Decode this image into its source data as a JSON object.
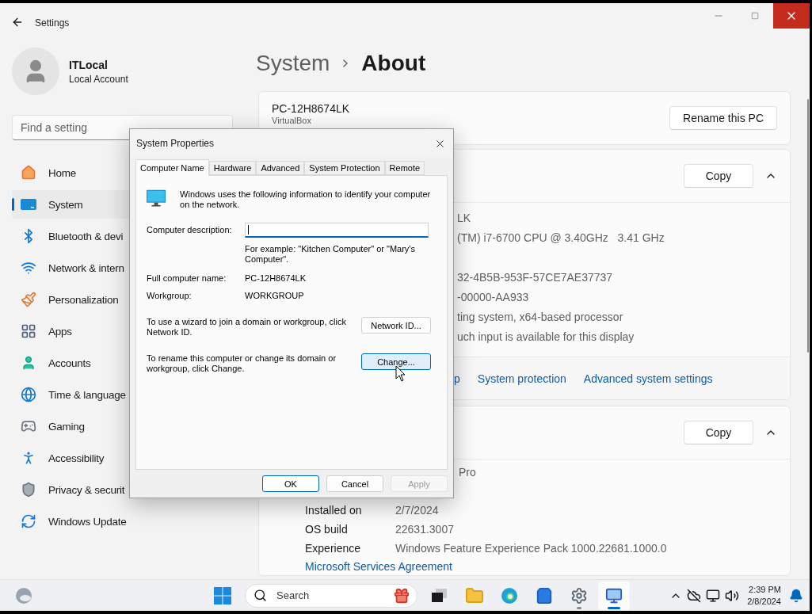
{
  "window": {
    "title": "Settings"
  },
  "profile": {
    "name": "ITLocal",
    "account": "Local Account"
  },
  "search": {
    "placeholder": "Find a setting"
  },
  "nav": [
    {
      "label": "Home",
      "selected": false
    },
    {
      "label": "System",
      "selected": true
    },
    {
      "label": "Bluetooth & devi",
      "selected": false
    },
    {
      "label": "Network & intern",
      "selected": false
    },
    {
      "label": "Personalization",
      "selected": false
    },
    {
      "label": "Apps",
      "selected": false
    },
    {
      "label": "Accounts",
      "selected": false
    },
    {
      "label": "Time & language",
      "selected": false
    },
    {
      "label": "Gaming",
      "selected": false
    },
    {
      "label": "Accessibility",
      "selected": false
    },
    {
      "label": "Privacy & securit",
      "selected": false
    },
    {
      "label": "Windows Update",
      "selected": false
    }
  ],
  "breadcrumb": {
    "parent": "System",
    "current": "About"
  },
  "device": {
    "name": "PC-12H8674LK",
    "model": "VirtualBox",
    "button": "Rename this PC"
  },
  "device_specs": {
    "button": "Copy",
    "expanded": true,
    "values": [
      {
        "value": "LK"
      },
      {
        "value": "(TM) i7-6700 CPU @ 3.40GHz   3.41 GHz"
      },
      {
        "value": "32-4B5B-953F-57CE7AE37737"
      },
      {
        "value": "-00000-AA933"
      },
      {
        "value": "ting system, x64-based processor"
      },
      {
        "value": "uch input is available for this display"
      }
    ],
    "links": [
      "p",
      "System protection",
      "Advanced system settings"
    ]
  },
  "windows_specs": {
    "button": "Copy",
    "expanded": true,
    "edition": "Pro",
    "rows": [
      {
        "label": "Installed on",
        "value": "2/7/2024"
      },
      {
        "label": "OS build",
        "value": "22631.3007"
      },
      {
        "label": "Experience",
        "value": "Windows Feature Experience Pack 1000.22681.1000.0"
      }
    ],
    "link": "Microsoft Services Agreement"
  },
  "dialog": {
    "title": "System Properties",
    "tabs": [
      {
        "label": "Computer Name",
        "selected": true
      },
      {
        "label": "Hardware",
        "selected": false
      },
      {
        "label": "Advanced",
        "selected": false
      },
      {
        "label": "System Protection",
        "selected": false
      },
      {
        "label": "Remote",
        "selected": false
      }
    ],
    "intro": "Windows uses the following information to identify your computer on the network.",
    "description": {
      "label": "Computer description:",
      "focused": true
    },
    "example": "For example: \"Kitchen Computer\" or \"Mary's Computer\".",
    "full_name": {
      "label": "Full computer name:",
      "value": "PC-12H8674LK"
    },
    "workgroup": {
      "label": "Workgroup:",
      "value": "WORKGROUP"
    },
    "actions": [
      {
        "text": "To use a wizard to join a domain or workgroup, click Network ID.",
        "button": "Network ID...",
        "hovered": false
      },
      {
        "text": "To rename this computer or change its domain or workgroup, click Change.",
        "button": "Change...",
        "hovered": true
      }
    ],
    "buttons": [
      {
        "label": "OK",
        "default": true,
        "disabled": false
      },
      {
        "label": "Cancel",
        "default": false,
        "disabled": false
      },
      {
        "label": "Apply",
        "default": false,
        "disabled": true
      }
    ]
  },
  "taskbar": {
    "search": {
      "placeholder": "Search"
    },
    "apps": [
      {
        "running": false,
        "active": false
      },
      {
        "running": false,
        "active": false
      },
      {
        "running": false,
        "active": false
      },
      {
        "running": false,
        "active": false
      },
      {
        "running": true,
        "active": false
      },
      {
        "running": true,
        "active": true
      }
    ],
    "clock": {
      "time": "2:39 PM",
      "date": "2/8/2024"
    }
  }
}
